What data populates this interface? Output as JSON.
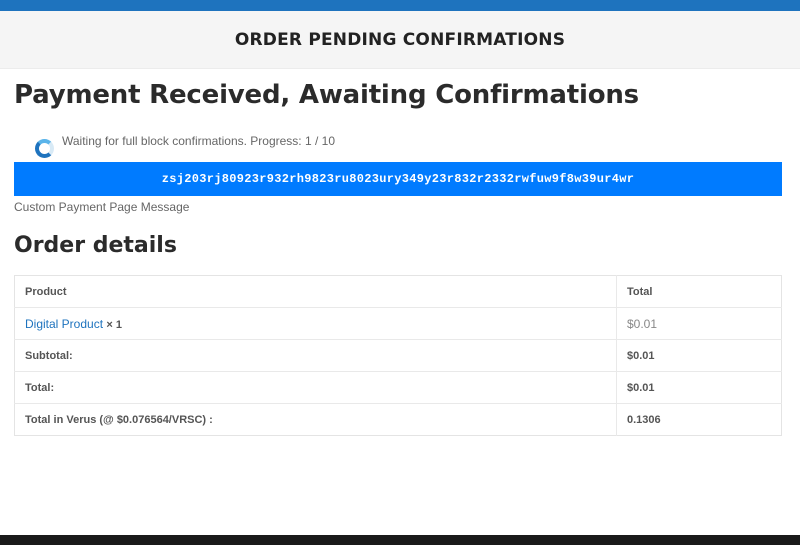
{
  "header": {
    "title": "ORDER PENDING CONFIRMATIONS"
  },
  "page": {
    "title": "Payment Received, Awaiting Confirmations",
    "progress_text": "Waiting for full block confirmations. Progress: 1 / 10",
    "progress": {
      "current": 1,
      "total": 10
    },
    "address": "zsj203rj80923r932rh9823ru8023ury349y23r832r2332rwfuw9f8w39ur4wr",
    "custom_message": "Custom Payment Page Message"
  },
  "order": {
    "title": "Order details",
    "columns": {
      "product": "Product",
      "total": "Total"
    },
    "item": {
      "name": "Digital Product",
      "qty": "× 1",
      "total": "$0.01"
    },
    "subtotal": {
      "label": "Subtotal:",
      "value": "$0.01"
    },
    "total": {
      "label": "Total:",
      "value": "$0.01"
    },
    "verus": {
      "label": "Total in Verus (@ $0.076564/VRSC) :",
      "value": "0.1306"
    }
  },
  "colors": {
    "accent": "#1e73be",
    "address_bg": "#007bff",
    "footer": "#1a1a1a"
  }
}
